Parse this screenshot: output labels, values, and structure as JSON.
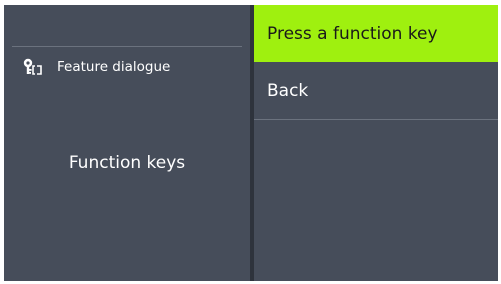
{
  "left_panel": {
    "feature_label": "Feature dialogue",
    "feature_icon": "key-speech-icon",
    "function_keys_label": "Function keys"
  },
  "menu": {
    "items": [
      {
        "label": "Press a function key",
        "selected": true
      },
      {
        "label": "Back",
        "selected": false
      }
    ]
  },
  "colors": {
    "background": "#464d5a",
    "highlight": "#9ff00f",
    "divider": "#2e333c"
  }
}
